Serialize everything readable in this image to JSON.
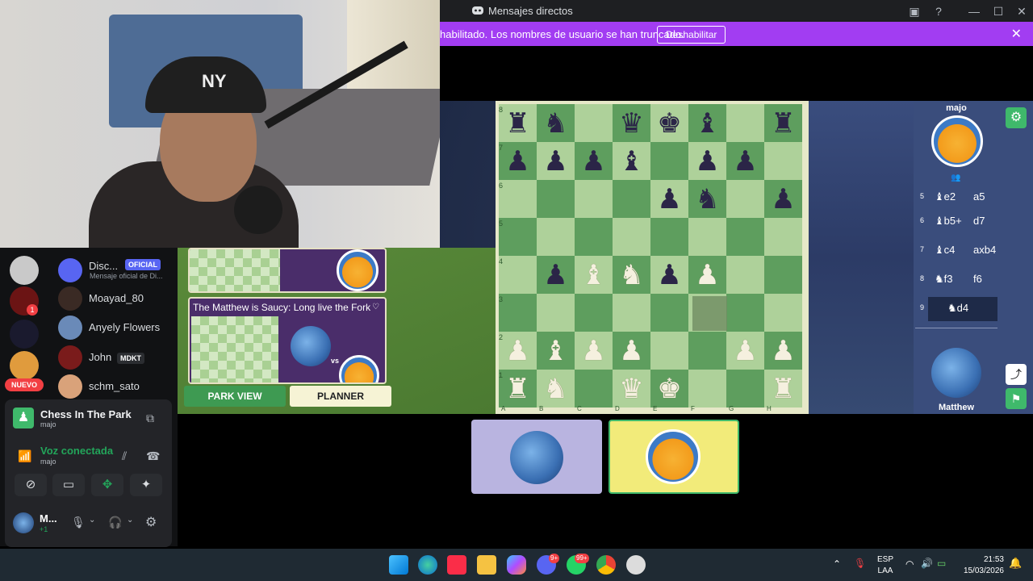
{
  "window": {
    "title": "Mensajes directos"
  },
  "banner": {
    "text": "habilitado. Los nombres de usuario se han truncado.",
    "button": "Deshabilitar"
  },
  "game": {
    "ranks": [
      "8",
      "7",
      "6",
      "5",
      "4",
      "3",
      "2",
      "1"
    ],
    "files": [
      "A",
      "B",
      "C",
      "D",
      "E",
      "F",
      "G",
      "H"
    ],
    "top_player": "majo",
    "bottom_player": "Matthew",
    "moves": [
      {
        "n": "5",
        "white": "♝e2",
        "black": "a5"
      },
      {
        "n": "6",
        "white": "♝b5+",
        "black": "d7"
      },
      {
        "n": "7",
        "white": "♝c4",
        "black": "axb4"
      },
      {
        "n": "8",
        "white": "♞f3",
        "black": "f6"
      },
      {
        "n": "9",
        "white": "♞d4",
        "black": ""
      }
    ],
    "board": [
      [
        "br",
        "bn",
        "",
        "bq",
        "bk",
        "bb",
        "",
        "br"
      ],
      [
        "bp",
        "bp",
        "bp",
        "bb",
        "",
        "bp",
        "bp",
        ""
      ],
      [
        "",
        "",
        "",
        "",
        "bp",
        "bn",
        "",
        "bp"
      ],
      [
        "",
        "",
        "",
        "",
        "",
        "",
        "",
        ""
      ],
      [
        "",
        "bp",
        "wb",
        "wn",
        "bp",
        "wp",
        "",
        ""
      ],
      [
        "",
        "",
        "",
        "",
        "",
        "",
        "",
        ""
      ],
      [
        "wp",
        "wb",
        "wp",
        "wp",
        "",
        "",
        "wp",
        "wp"
      ],
      [
        "wr",
        "wn",
        "",
        "wq",
        "wk",
        "",
        "",
        "wr"
      ]
    ]
  },
  "activities": {
    "card2_title": "The Matthew is Saucy: Long live the Fork",
    "vs": "vs",
    "park_view": "PARK VIEW",
    "planner": "PLANNER"
  },
  "sidebar": {
    "dms": [
      {
        "name": "Disc...",
        "badge": "OFICIAL",
        "sub": "Mensaje oficial de Di..."
      },
      {
        "name": "Moayad_80"
      },
      {
        "name": "Anyely Flowers"
      },
      {
        "name": "John",
        "badge": "MDKT"
      },
      {
        "name": "schm_sato"
      }
    ],
    "nuevo": "NUEVO",
    "guild_badge": "1",
    "app_title": "Chess In The Park",
    "app_sub": "majo",
    "voice_status": "Voz conectada",
    "voice_sub": "majo",
    "user_name": "M...",
    "user_status": "+1"
  },
  "taskbar": {
    "lang": "ESP",
    "layout": "LAA",
    "time": "21:53",
    "date": "15/03/2026",
    "badge_discord": "9+",
    "badge_whatsapp": "99+"
  },
  "icons": {
    "accent": "#a23df2",
    "discord_blurple": "#5865f2",
    "voice_green": "#23a55a"
  }
}
